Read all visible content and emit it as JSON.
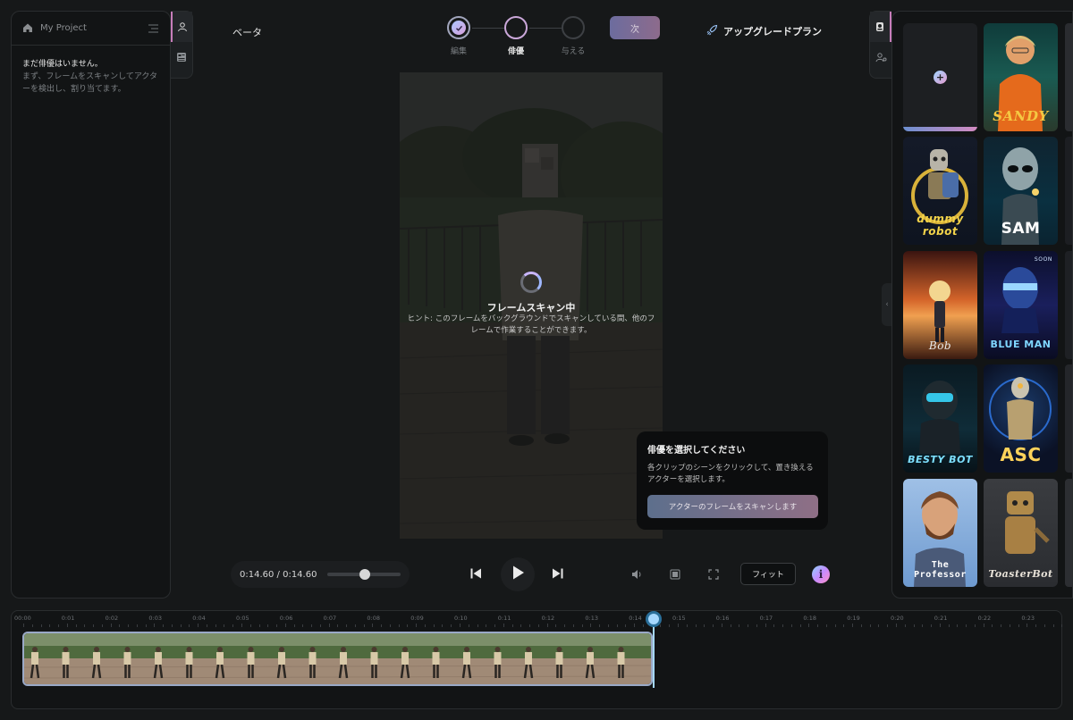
{
  "project": {
    "title": "My Project"
  },
  "left_panel": {
    "empty_title": "まだ俳優はいません。",
    "empty_hint": "まず、フレームをスキャンしてアクターを検出し、割り当てます。"
  },
  "header": {
    "beta_label": "ベータ",
    "steps": [
      {
        "label": "編集",
        "state": "done"
      },
      {
        "label": "俳優",
        "state": "active"
      },
      {
        "label": "与える",
        "state": "pending"
      }
    ],
    "next_label": "次",
    "upgrade_label": "アップグレードプラン"
  },
  "video": {
    "scan_title": "フレームスキャン中",
    "scan_hint": "ヒント: このフレームをバックグラウンドでスキャンしている間、他のフレームで作業することができます。"
  },
  "popover": {
    "title": "俳優を選択してください",
    "description": "各クリップのシーンをクリックして、置き換えるアクターを選択します。",
    "button_label": "アクターのフレームをスキャンします"
  },
  "player": {
    "time_display": "0:14.60 / 0:14.60",
    "progress": 0.45,
    "fit_label": "フィット",
    "info_glyph": "i"
  },
  "actors": [
    {
      "name": "SANDY",
      "color": "#f5c842"
    },
    {
      "name": "dummy robot",
      "color": "#f2d34a"
    },
    {
      "name": "SAM",
      "color": "#ffffff"
    },
    {
      "name": "Bob",
      "color": "#e9e9e9"
    },
    {
      "name": "BLUE MAN",
      "color": "#7fd6ff",
      "badge": "SOON"
    },
    {
      "name": "BESTY BOT",
      "color": "#7ee0ff"
    },
    {
      "name": "ASC",
      "color": "#ffd35a"
    },
    {
      "name": "The Professor",
      "color": "#ffffff"
    },
    {
      "name": "ToasterBot",
      "color": "#e8e2d8"
    }
  ],
  "timeline": {
    "ticks": [
      "00:00",
      "0:01",
      "0:02",
      "0:03",
      "0:04",
      "0:05",
      "0:06",
      "0:07",
      "0:08",
      "0:09",
      "0:10",
      "0:11",
      "0:12",
      "0:13",
      "0:14",
      "0:15",
      "0:16",
      "0:17",
      "0:18",
      "0:19",
      "0:20",
      "0:21",
      "0:22",
      "0:23"
    ]
  },
  "icons": {
    "home": "home-icon",
    "menu": "menu-icon",
    "person": "person-icon",
    "layout": "layout-icon",
    "rocket": "rocket-icon",
    "check": "check-icon",
    "skip_back": "skip-back-icon",
    "play": "play-icon",
    "skip_forward": "skip-forward-icon",
    "volume": "volume-icon",
    "frame": "frame-icon",
    "fullscreen": "fullscreen-icon",
    "actor": "actor-icon",
    "person_settings": "person-settings-icon",
    "plus": "plus-icon"
  }
}
